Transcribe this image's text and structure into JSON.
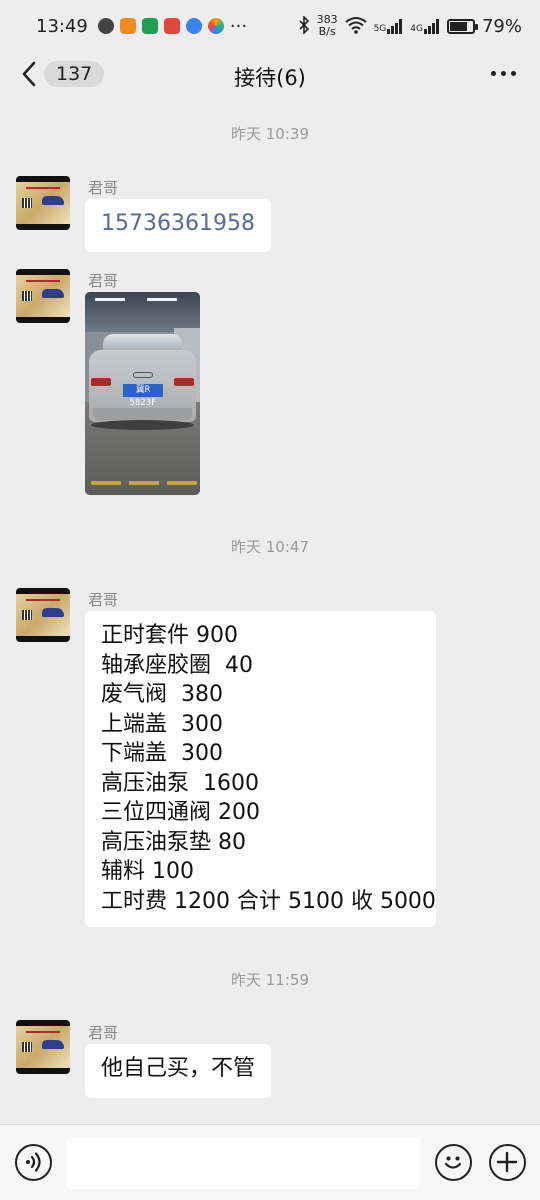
{
  "status_bar": {
    "time": "13:49",
    "network_speed_value": "383",
    "network_speed_unit": "B/s",
    "signal_1_label": "5G",
    "signal_2_label": "4G",
    "battery_percent_text": "79%",
    "battery_level": 0.79,
    "more_notifications": "···"
  },
  "nav": {
    "unread_count": "137",
    "title": "接待(6)"
  },
  "messages": {
    "timestamp_1": "昨天 10:39",
    "msg1_sender": "君哥",
    "msg1_text": "15736361958",
    "msg2_sender": "君哥",
    "msg2_photo_plate": "冀R 5823F",
    "timestamp_2": "昨天 10:47",
    "msg3_sender": "君哥",
    "msg3_lines": [
      "正时套件 900",
      "轴承座胶圈  40",
      "废气阀  380",
      "上端盖  300",
      "下端盖  300",
      "高压油泵  1600",
      "三位四通阀 200",
      "高压油泵垫 80",
      "辅料 100",
      "工时费 1200 合计 5100 收 5000"
    ],
    "timestamp_3": "昨天 11:59",
    "msg4_sender": "君哥",
    "msg4_text": "他自己买，不管"
  },
  "input_bar": {
    "voice_icon": "voice-icon",
    "emoji_icon": "emoji-icon",
    "plus_icon": "plus-icon",
    "text_value": ""
  },
  "colors": {
    "background": "#ededed",
    "bubble": "#ffffff",
    "link": "#576b95",
    "timestamp": "#9a9a9a"
  }
}
